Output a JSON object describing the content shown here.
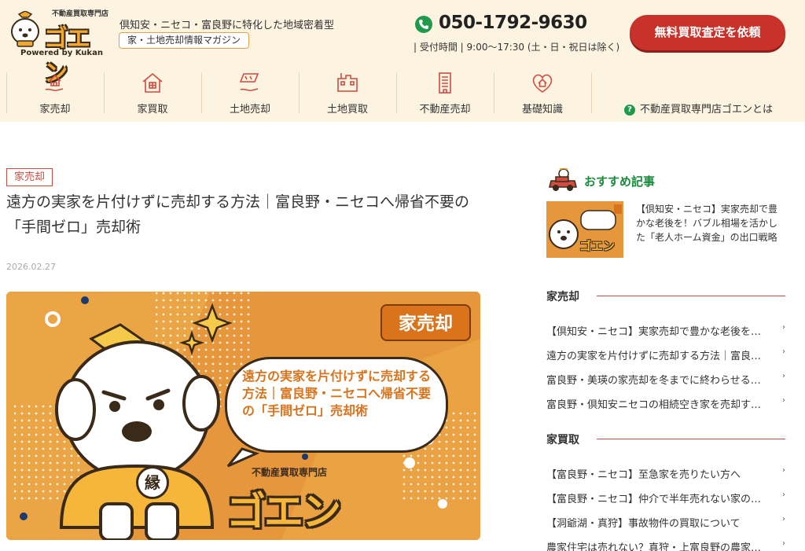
{
  "header": {
    "logo_small": "不動産買取専門店",
    "logo_word": "ゴエン",
    "logo_powered": "Powered by Kukan",
    "tagline": "倶知安・ニセコ・富良野に特化した地域密着型",
    "tag_pill": "家・土地売却情報マガジン",
    "phone": "050-1792-9630",
    "hours": "| 受付時間 | 9:00〜17:30 (土・日・祝日は除く)",
    "cta": "無料買取査定を依頼"
  },
  "nav": {
    "items": [
      {
        "label": "家売却",
        "icon": "house-hand-icon"
      },
      {
        "label": "家買取",
        "icon": "house-icon"
      },
      {
        "label": "土地売却",
        "icon": "land-hand-icon"
      },
      {
        "label": "土地買取",
        "icon": "land-icon"
      },
      {
        "label": "不動産売却",
        "icon": "building-icon"
      },
      {
        "label": "基礎知識",
        "icon": "heart-house-icon"
      }
    ],
    "about_label": "不動産買取専門店ゴエンとは",
    "about_icon": "question-icon"
  },
  "article": {
    "category": "家売却",
    "title": "遠方の実家を片付けずに売却する方法｜富良野・ニセコへ帰省不要の「手間ゼロ」売却術",
    "date": "2026.02.27",
    "hero": {
      "badge": "家売却",
      "bubble": "遠方の実家を片付けずに売却する方法｜富良野・ニセコへ帰省不要の「手間ゼロ」売却術",
      "shop": "不動産買取専門店",
      "logo": "ゴエン",
      "en": "縁"
    }
  },
  "sidebar": {
    "recommend_title": "おすすめ記事",
    "recommend_text": "【倶知安・ニセコ】実家売却で豊かな老後を！バブル相場を活かした「老人ホーム資金」の出口戦略",
    "recommend_thumb_logo": "ゴエン",
    "sections": [
      {
        "title": "家売却",
        "links": [
          "【倶知安・ニセコ】実家売却で豊かな老後を！バブル相場を活かした「老人ホーム資金」の出口戦略",
          "遠方の実家を片付けずに売却する方法｜富良野・ニセコへ帰省不要の「手間ゼロ」売却術",
          "富良野・美瑛の家売却を冬までに終わらせるべき理由",
          "富良野・倶知安ニセコの相続空き家を売却するなら"
        ]
      },
      {
        "title": "家買取",
        "links": [
          "【富良野・ニセコ】至急家を売りたい方へ",
          "【富良野・ニセコ】仲介で半年売れない家の買取",
          "【洞爺湖・真狩】事故物件の買取について",
          "農家住宅は売れない？真狩・上富良野の農家住宅買取"
        ]
      }
    ]
  },
  "colors": {
    "header_bg": "#fdf3e1",
    "accent_red": "#c8322a",
    "accent_green": "#1e9a4a",
    "hero_orange": "#e6973c"
  }
}
